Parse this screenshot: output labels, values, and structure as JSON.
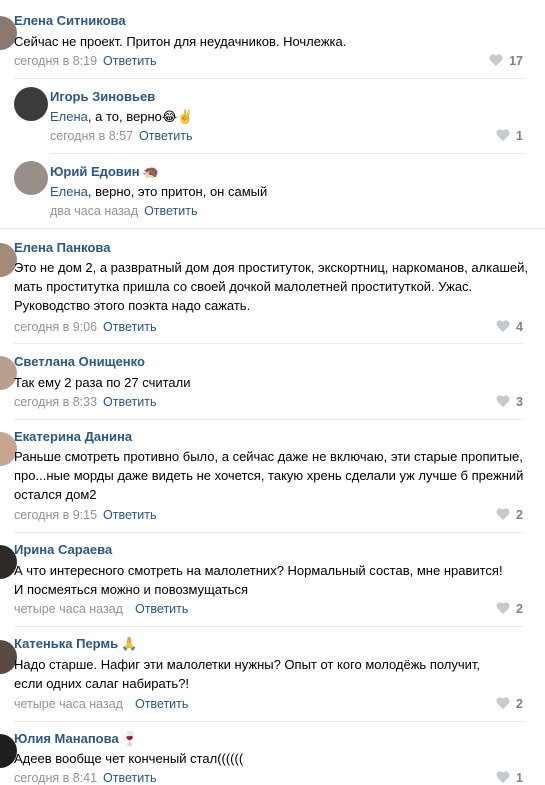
{
  "comments": [
    {
      "author": "Елена Ситникова",
      "emoji": "",
      "text": "Сейчас не проект. Притон для неудачников. Ночлежка.",
      "mention": "",
      "time": "сегодня в 8:19",
      "reply": "Ответить",
      "likes": "17"
    },
    {
      "author": "Игорь Зиновьев",
      "emoji": "",
      "text": ", а то, верно😂✌️",
      "mention": "Елена",
      "time": "сегодня в 8:57",
      "reply": "Ответить",
      "likes": "1"
    },
    {
      "author": "Юрий Едовин",
      "emoji": "🦔",
      "text": ", верно, это притон, он самый",
      "mention": "Елена",
      "time": "два часа назад",
      "reply": "Ответить",
      "likes": ""
    },
    {
      "author": "Елена Панкова",
      "emoji": "",
      "text": "Это не дом 2, а развратный дом доя проституток, экскортниц, наркоманов, алкашей, мать проститутка пришла со своей дочкой малолетней проституткой. Ужас. Руководство этого поэкта надо сажать.",
      "mention": "",
      "time": "сегодня в 9:06",
      "reply": "Ответить",
      "likes": "4"
    },
    {
      "author": "Светлана Онищенко",
      "emoji": "",
      "text": "Так ему 2 раза по 27 считали",
      "mention": "",
      "time": "сегодня в 8:33",
      "reply": "Ответить",
      "likes": "3"
    },
    {
      "author": "Екатерина Данина",
      "emoji": "",
      "text": "Раньше смотреть противно было, а сейчас даже не включаю, эти старые пропитые, про...ные морды даже видеть не хочется, такую хрень сделали уж лучше б прежний остался дом2",
      "mention": "",
      "time": "сегодня в 9:15",
      "reply": "Ответить",
      "likes": "2"
    },
    {
      "author": "Ирина Сараева",
      "emoji": "",
      "text": "А что интересного смотреть на малолетних? Нормальный состав, мне нравится! И посмеяться можно и повозмущаться",
      "mention": "",
      "time": "четыре часа назад",
      "reply": "Ответить",
      "likes": "2"
    },
    {
      "author": "Катенька Пермь",
      "emoji": "🙏",
      "text": "Надо старше. Нафиг эти малолетки нужны? Опыт от кого молодёжь получит, если одних салаг набирать?!",
      "mention": "",
      "time": "четыре часа назад",
      "reply": "Ответить",
      "likes": "2"
    },
    {
      "author": "Юлия Манапова",
      "emoji": "🍷",
      "text": "Адеев вообще чет конченый стал((((((",
      "mention": "",
      "time": "сегодня в 8:41",
      "reply": "Ответить",
      "likes": "1"
    }
  ]
}
